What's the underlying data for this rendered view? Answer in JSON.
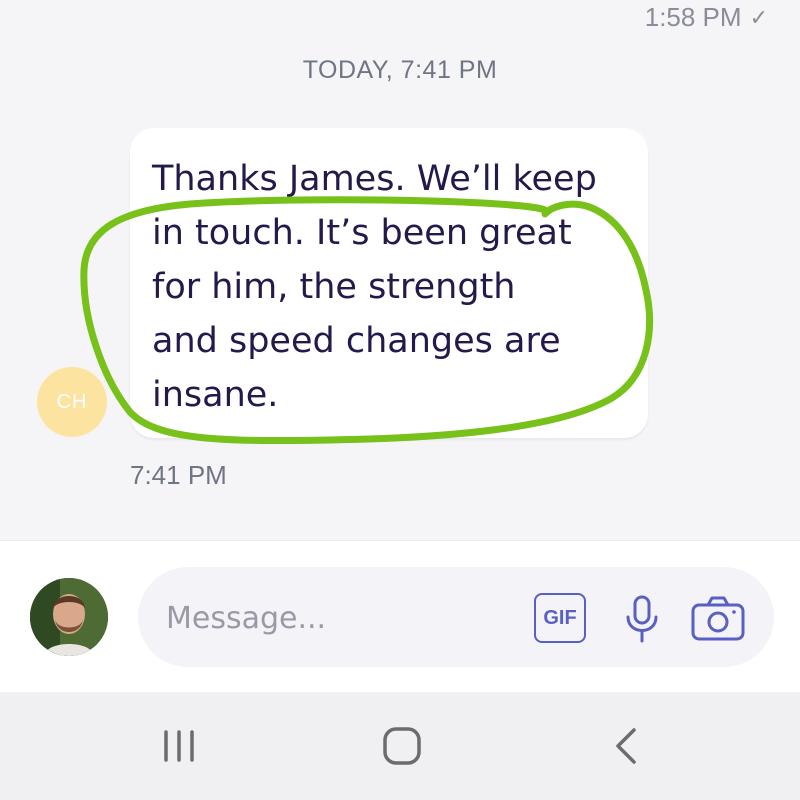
{
  "previous_message": {
    "time": "1:58 PM",
    "status_icon": "check-icon"
  },
  "day_separator": "TODAY, 7:41 PM",
  "message": {
    "sender_initials": "CH",
    "text": "Thanks James. We’ll keep\nin touch.  It’s been great\nfor him, the strength\nand speed changes are\ninsane.",
    "time": "7:41 PM",
    "annotation_color": "#77c11a"
  },
  "composer": {
    "placeholder": "Message...",
    "gif_label": "GIF",
    "mic_icon": "microphone-icon",
    "camera_icon": "camera-icon",
    "accent_color": "#5a5fc4"
  },
  "nav_bar": {
    "recents_icon": "recents-icon",
    "home_icon": "home-icon",
    "back_icon": "back-icon"
  }
}
